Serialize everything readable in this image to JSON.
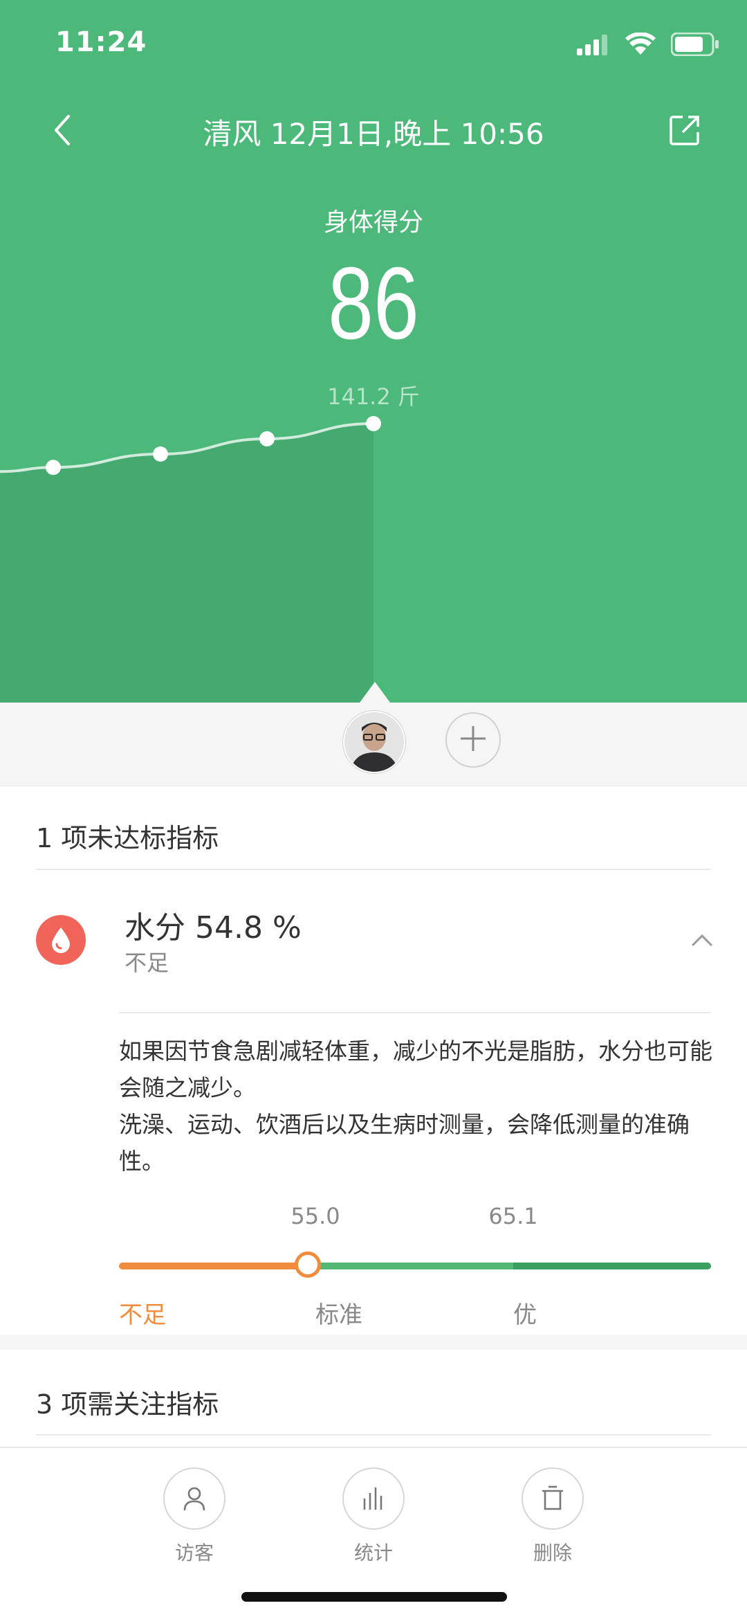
{
  "status_bar": {
    "time": "11:24",
    "icons": [
      "signal-icon",
      "wifi-icon",
      "battery-icon"
    ]
  },
  "header": {
    "title": "清风 12月1日,晚上 10:56",
    "back_icon": "chevron-left-icon",
    "share_icon": "share-icon"
  },
  "score": {
    "label": "身体得分",
    "value": "86",
    "weight": "141.2 斤"
  },
  "trend": {
    "points": [
      138.9,
      139.6,
      140.4,
      141.2
    ]
  },
  "users": {
    "avatar_icon": "avatar",
    "add_icon": "plus-icon"
  },
  "unmet": {
    "title": "1 项未达标指标",
    "item": {
      "icon": "water-drop-icon",
      "name": "水分 54.8 %",
      "status": "不足",
      "collapse_icon": "chevron-up-icon",
      "description": "如果因节食急剧减轻体重，减少的不光是脂肪，水分也可能会随之减少。\n洗澡、运动、饮酒后以及生病时测量，会降低测量的准确性。",
      "value": 54.8,
      "scale": {
        "thresholds": [
          "55.0",
          "65.1"
        ],
        "labels": [
          "不足",
          "标准",
          "优"
        ]
      }
    }
  },
  "attention": {
    "title": "3 项需关注指标"
  },
  "tabs": [
    {
      "label": "访客",
      "icon": "person-icon"
    },
    {
      "label": "统计",
      "icon": "bar-chart-icon"
    },
    {
      "label": "删除",
      "icon": "trash-icon"
    }
  ],
  "colors": {
    "hero_green": "#4cb97b",
    "low_orange": "#f08c3c",
    "standard_green": "#52b875",
    "excellent_green": "#3a9f5f",
    "drop_red": "#f0645a"
  }
}
